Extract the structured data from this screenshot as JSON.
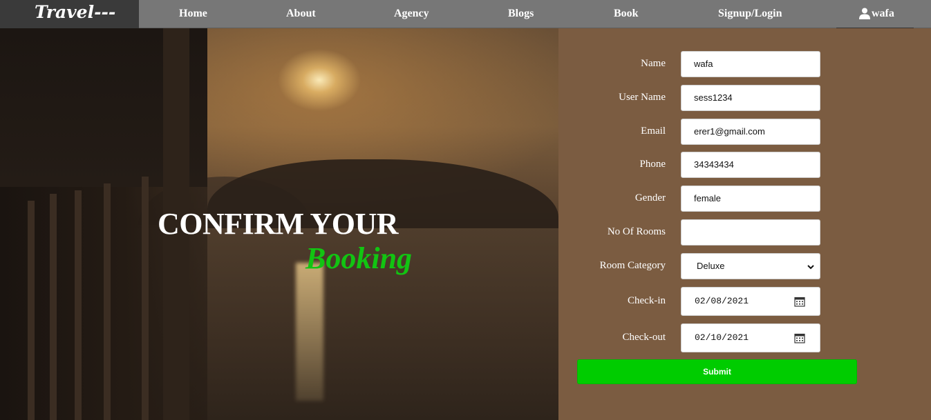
{
  "brand": {
    "logo": "Travel---"
  },
  "nav": {
    "items": [
      {
        "label": "Home"
      },
      {
        "label": "About"
      },
      {
        "label": "Agency"
      },
      {
        "label": "Blogs"
      },
      {
        "label": "Book"
      },
      {
        "label": "Signup/Login"
      }
    ],
    "user": {
      "name": "wafa",
      "icon": "user-icon"
    }
  },
  "hero": {
    "title": "CONFIRM YOUR",
    "subtitle": "Booking",
    "subtitle_color": "#12c412"
  },
  "form": {
    "fields": [
      {
        "label": "Name",
        "value": "wafa"
      },
      {
        "label": "User Name",
        "value": "sess1234"
      },
      {
        "label": "Email",
        "value": "erer1@gmail.com"
      },
      {
        "label": "Phone",
        "value": "34343434"
      },
      {
        "label": "Gender",
        "value": "female"
      },
      {
        "label": "No Of Rooms",
        "value": ""
      },
      {
        "label": "Room Category",
        "value": "Deluxe"
      },
      {
        "label": "Check-in",
        "value": "02/08/2021"
      },
      {
        "label": "Check-out",
        "value": "02/10/2021"
      }
    ],
    "submit_label": "Submit",
    "submit_color": "#00cc00"
  },
  "colors": {
    "navbar": "#777777",
    "logo_bg": "#3a3a3a",
    "panel": "#7b5c41"
  }
}
